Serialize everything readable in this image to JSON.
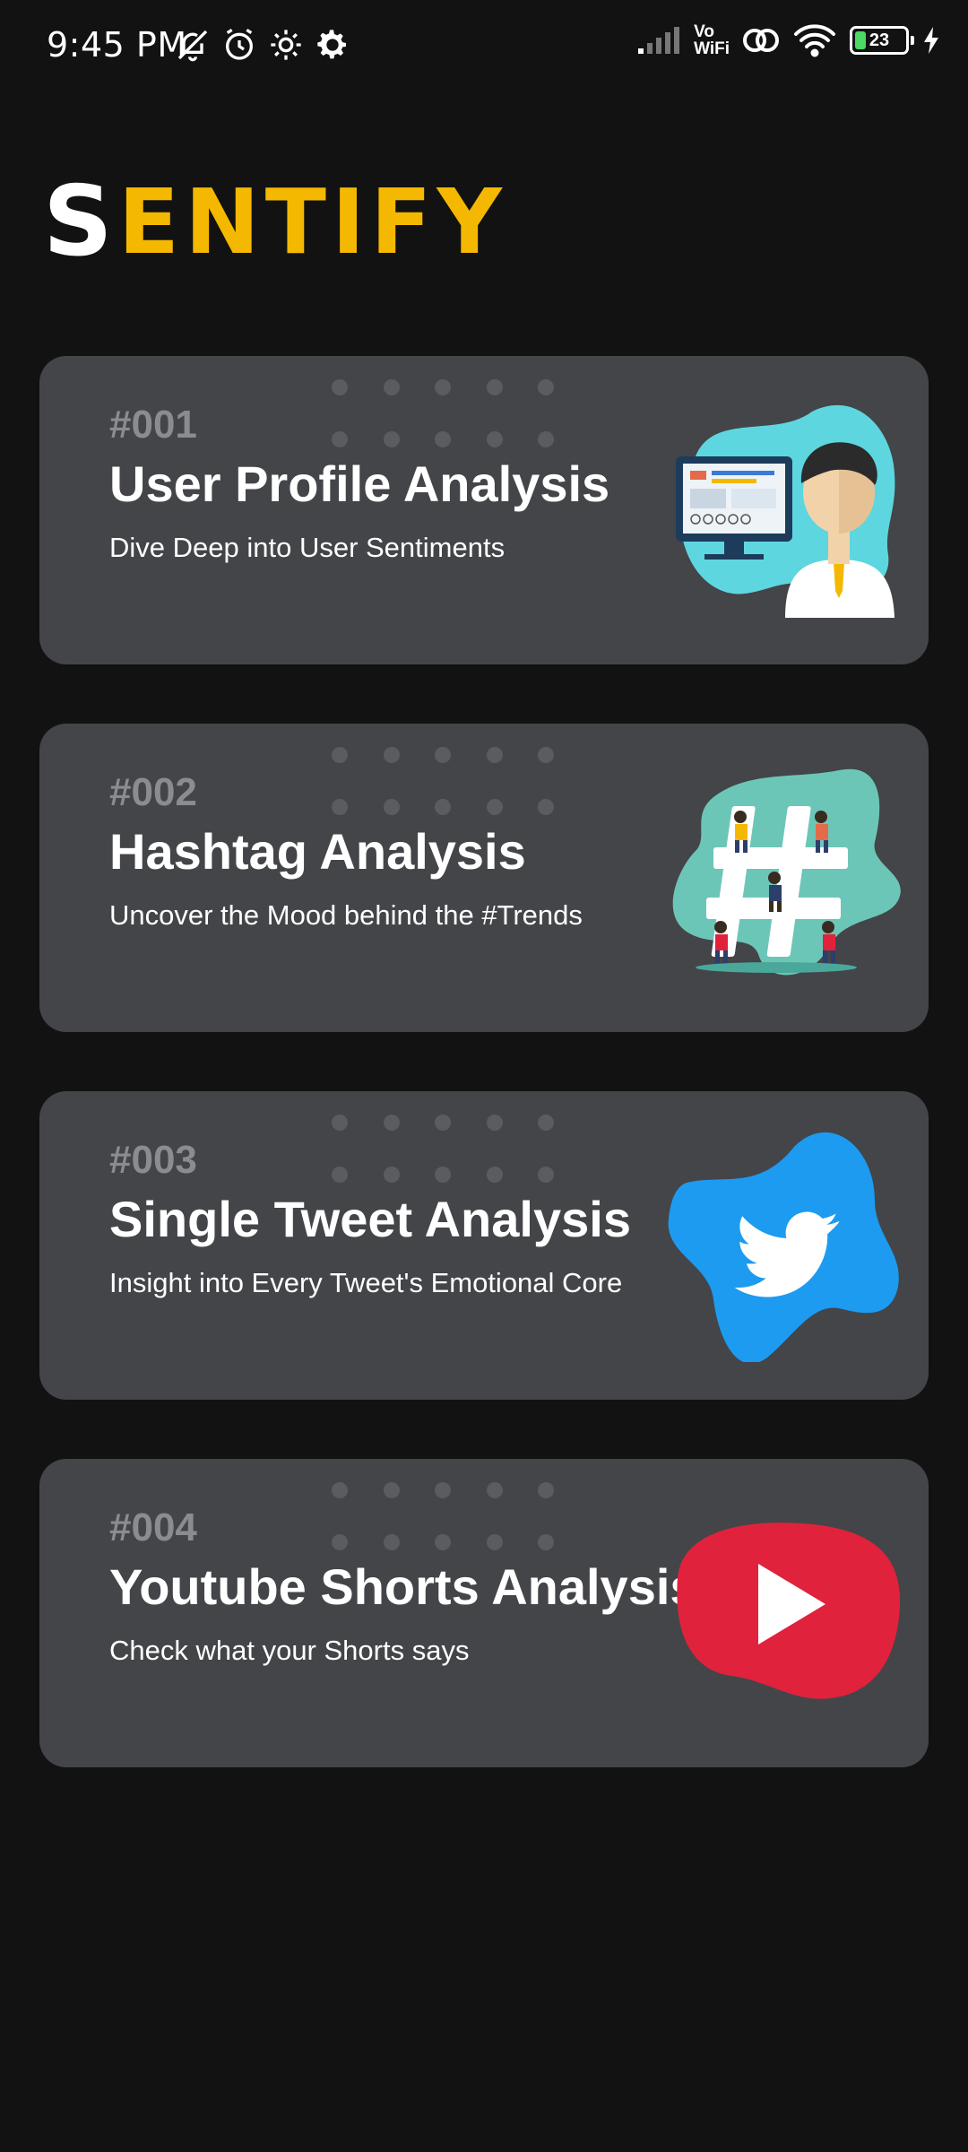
{
  "status_bar": {
    "time": "9:45 PM",
    "network_label_top": "Vo",
    "network_label_bottom": "WiFi",
    "battery_level": "23",
    "battery_fraction": 0.23,
    "icons": [
      "bell-off-icon",
      "alarm-icon",
      "settings-icon",
      "gear-icon",
      "signal-icon",
      "vowifi-icon",
      "hotspot-icon",
      "wifi-icon",
      "battery-icon",
      "charging-icon"
    ]
  },
  "app": {
    "logo_first": "S",
    "logo_rest": "ENTIFY",
    "accent_color": "#f5b800"
  },
  "cards": [
    {
      "number": "#001",
      "title": "User Profile Analysis",
      "subtitle": "Dive Deep into User Sentiments",
      "art": "user-profile-illustration",
      "blob_color": "#5ed6e0"
    },
    {
      "number": "#002",
      "title": "Hashtag Analysis",
      "subtitle": "Uncover the Mood behind the #Trends",
      "art": "hashtag-illustration",
      "blob_color": "#6cc6b8"
    },
    {
      "number": "#003",
      "title": "Single Tweet Analysis",
      "subtitle": "Insight into Every Tweet's Emotional Core",
      "art": "twitter-bird-icon",
      "blob_color": "#1d9bf0"
    },
    {
      "number": "#004",
      "title": "Youtube Shorts Analysis",
      "subtitle": "Check what your Shorts says",
      "art": "youtube-play-icon",
      "blob_color": "#e0223c"
    }
  ]
}
